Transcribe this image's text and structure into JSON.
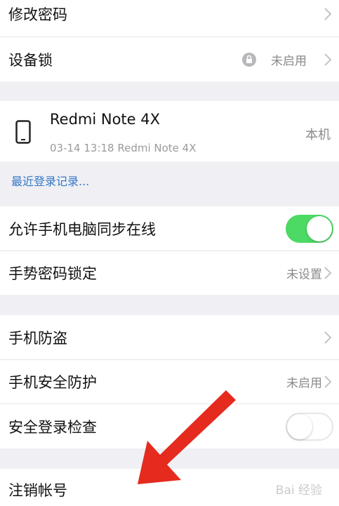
{
  "rows": {
    "change_password": {
      "label": "修改密码"
    },
    "device_lock": {
      "label": "设备锁",
      "value": "未启用"
    },
    "device": {
      "name": "Redmi Note 4X",
      "sub": "03-14 13:18 Redmi Note 4X",
      "tag": "本机"
    },
    "recent_login": {
      "label": "最近登录记录..."
    },
    "sync_online": {
      "label": "允许手机电脑同步在线",
      "enabled": true
    },
    "gesture_lock": {
      "label": "手势密码锁定",
      "value": "未设置"
    },
    "anti_theft": {
      "label": "手机防盗"
    },
    "security_protect": {
      "label": "手机安全防护",
      "value": "未启用"
    },
    "login_check": {
      "label": "安全登录检查",
      "enabled": false
    },
    "cancel_account": {
      "label": "注销帐号"
    }
  },
  "colors": {
    "accent_green": "#4cd964",
    "link_blue": "#3478c6",
    "arrow_red": "#e52a1e"
  },
  "watermark": "Bai 经验"
}
